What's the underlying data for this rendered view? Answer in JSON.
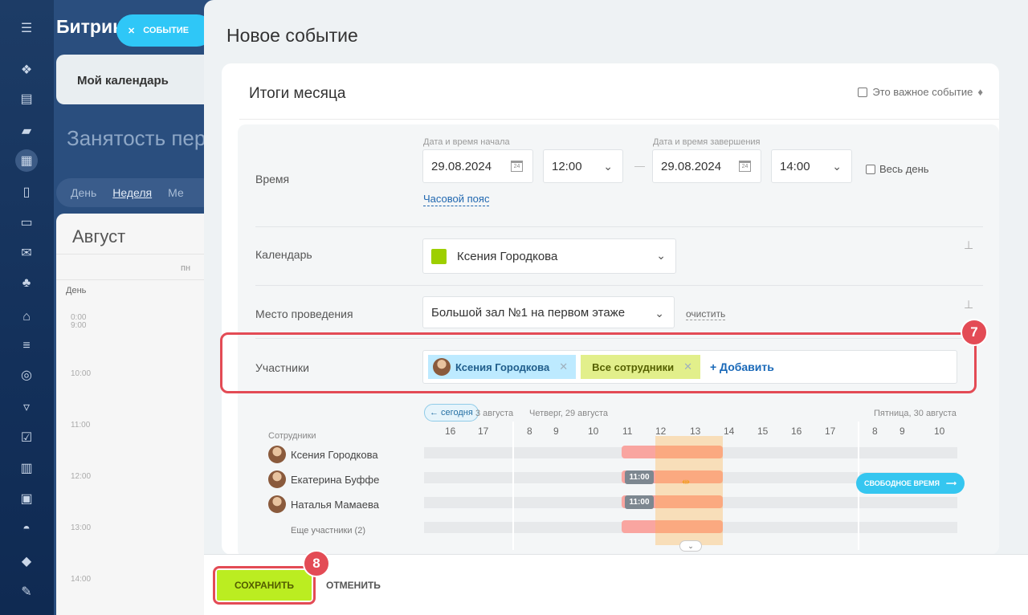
{
  "app": {
    "title_partial": "Битрик",
    "event_chip": "СОБЫТИЕ",
    "my_calendar": "Мой календарь",
    "page_heading_partial": "Занятость пере",
    "views": [
      "День",
      "Неделя",
      "Ме"
    ],
    "selected_view": "Неделя",
    "month": "Август",
    "dow": "пн",
    "day_label": "День",
    "hours": [
      "0:00",
      "9:00",
      "10:00",
      "11:00",
      "12:00",
      "13:00",
      "14:00"
    ]
  },
  "panel": {
    "title": "Новое событие",
    "event_name": "Итоги месяца",
    "important_label": "Это важное событие"
  },
  "time": {
    "label": "Время",
    "start_caption": "Дата и время начала",
    "end_caption": "Дата и время завершения",
    "start_date": "29.08.2024",
    "start_time": "12:00",
    "end_date": "29.08.2024",
    "end_time": "14:00",
    "dash": "—",
    "all_day": "Весь день",
    "timezone_link": "Часовой пояс",
    "calendar_icon_day": "24"
  },
  "calendar": {
    "label": "Календарь",
    "value": "Ксения Городкова",
    "color": "#9dcf00"
  },
  "location": {
    "label": "Место проведения",
    "value": "Большой зал №1 на первом этаже",
    "clear": "очистить"
  },
  "participants": {
    "label": "Участники",
    "tags": [
      "Ксения Городкова",
      "Все сотрудники"
    ],
    "add": "+ Добавить"
  },
  "timeline": {
    "today_btn": "← сегодня",
    "days": [
      "3 августа",
      "Четверг, 29 августа",
      "Пятница, 30 августа"
    ],
    "hours": [
      "16",
      "17",
      "8",
      "9",
      "10",
      "11",
      "12",
      "13",
      "14",
      "15",
      "16",
      "17",
      "8",
      "9",
      "10"
    ],
    "employees_title": "Сотрудники",
    "employees": [
      "Ксения Городкова",
      "Екатерина Буффе",
      "Наталья Мамаева"
    ],
    "busy_time_label": "11:00",
    "more_participants": "Еще участники (2)",
    "free_time_btn": "СВОБОДНОЕ ВРЕМЯ"
  },
  "footer": {
    "save": "СОХРАНИТЬ",
    "cancel": "ОТМЕНИТЬ"
  },
  "annotations": {
    "step_participants": "7",
    "step_save": "8"
  }
}
